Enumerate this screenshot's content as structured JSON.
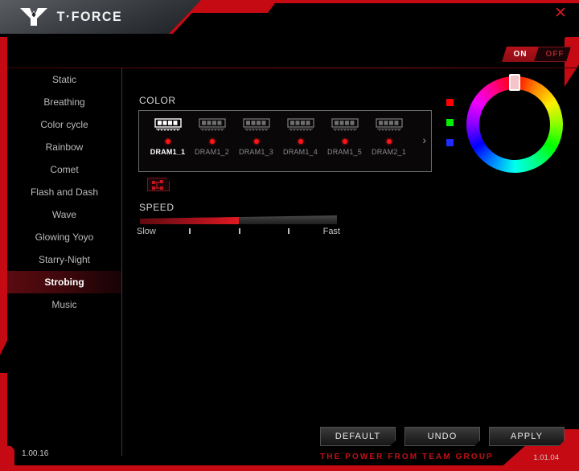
{
  "app": {
    "brand": "T·FORCE",
    "logo_icon": "tforce-logo-icon",
    "close_icon": "close-icon",
    "version_left": "1.00.16",
    "version_right": "1.01.04",
    "tagline": "THE POWER FROM TEAM GROUP"
  },
  "power": {
    "on_label": "ON",
    "off_label": "OFF",
    "state": "ON",
    "accent": "#b51119"
  },
  "sidebar": {
    "items": [
      {
        "label": "Static",
        "active": false
      },
      {
        "label": "Breathing",
        "active": false
      },
      {
        "label": "Color cycle",
        "active": false
      },
      {
        "label": "Rainbow",
        "active": false
      },
      {
        "label": "Comet",
        "active": false
      },
      {
        "label": "Flash and Dash",
        "active": false
      },
      {
        "label": "Wave",
        "active": false
      },
      {
        "label": "Glowing Yoyo",
        "active": false
      },
      {
        "label": "Starry-Night",
        "active": false
      },
      {
        "label": "Strobing",
        "active": true
      },
      {
        "label": "Music",
        "active": false
      }
    ]
  },
  "color_section": {
    "label": "COLOR",
    "next_icon": "chevron-right-icon",
    "sync_icon": "sync-link-icon",
    "modules": [
      {
        "name": "DRAM1_1",
        "selected": true,
        "led": "#ff1414"
      },
      {
        "name": "DRAM1_2",
        "selected": false,
        "led": "#ff1414"
      },
      {
        "name": "DRAM1_3",
        "selected": false,
        "led": "#ff1414"
      },
      {
        "name": "DRAM1_4",
        "selected": false,
        "led": "#ff1414"
      },
      {
        "name": "DRAM1_5",
        "selected": false,
        "led": "#ff1414"
      },
      {
        "name": "DRAM2_1",
        "selected": false,
        "led": "#ff1414"
      }
    ]
  },
  "speed_section": {
    "label": "SPEED",
    "min_label": "Slow",
    "max_label": "Fast",
    "value_percent": 50,
    "tick_count": 3
  },
  "color_wheel": {
    "handle_position": "top",
    "selected_hue_deg": 0,
    "swatches": [
      {
        "name": "red-swatch",
        "color": "#ff0000"
      },
      {
        "name": "green-swatch",
        "color": "#00ee00"
      },
      {
        "name": "blue-swatch",
        "color": "#1f2bff"
      }
    ]
  },
  "footer": {
    "default_label": "DEFAULT",
    "undo_label": "UNDO",
    "apply_label": "APPLY"
  }
}
